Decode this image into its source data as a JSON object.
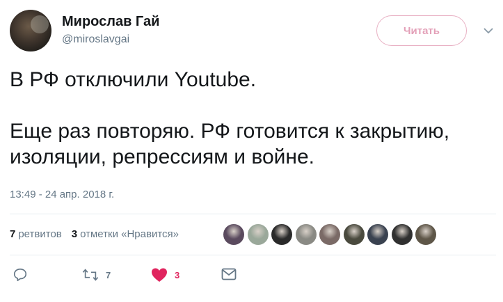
{
  "author": {
    "name": "Мирослав Гай",
    "handle": "@miroslavgai",
    "follow_label": "Читать"
  },
  "tweet": {
    "text": "В РФ отключили Youtube.\n\nЕще раз повторяю. РФ готовится к закрытию, изоляции, репрессиям и войне.",
    "timestamp": "13:49 - 24 апр. 2018 г."
  },
  "stats": {
    "retweets_count": "7",
    "retweets_label": "ретвитов",
    "likes_count": "3",
    "likes_label": "отметки «Нравится»"
  },
  "likers": [
    {
      "name": "liker-avatar-1",
      "color": "#5a4a5e"
    },
    {
      "name": "liker-avatar-2",
      "color": "#9aa89a"
    },
    {
      "name": "liker-avatar-3",
      "color": "#2a2a2a"
    },
    {
      "name": "liker-avatar-4",
      "color": "#8a8a84"
    },
    {
      "name": "liker-avatar-5",
      "color": "#7a6a66"
    },
    {
      "name": "liker-avatar-6",
      "color": "#4a4a3e"
    },
    {
      "name": "liker-avatar-7",
      "color": "#3a4250"
    },
    {
      "name": "liker-avatar-8",
      "color": "#303030"
    },
    {
      "name": "liker-avatar-9",
      "color": "#5e5648"
    }
  ],
  "actions": {
    "retweet_count": "7",
    "like_count": "3"
  },
  "colors": {
    "like_active": "#e0245e",
    "secondary": "#657786",
    "follow_border": "#e8b0c3"
  },
  "icons": [
    "reply-icon",
    "retweet-icon",
    "heart-icon",
    "envelope-icon",
    "chevron-down-icon"
  ]
}
